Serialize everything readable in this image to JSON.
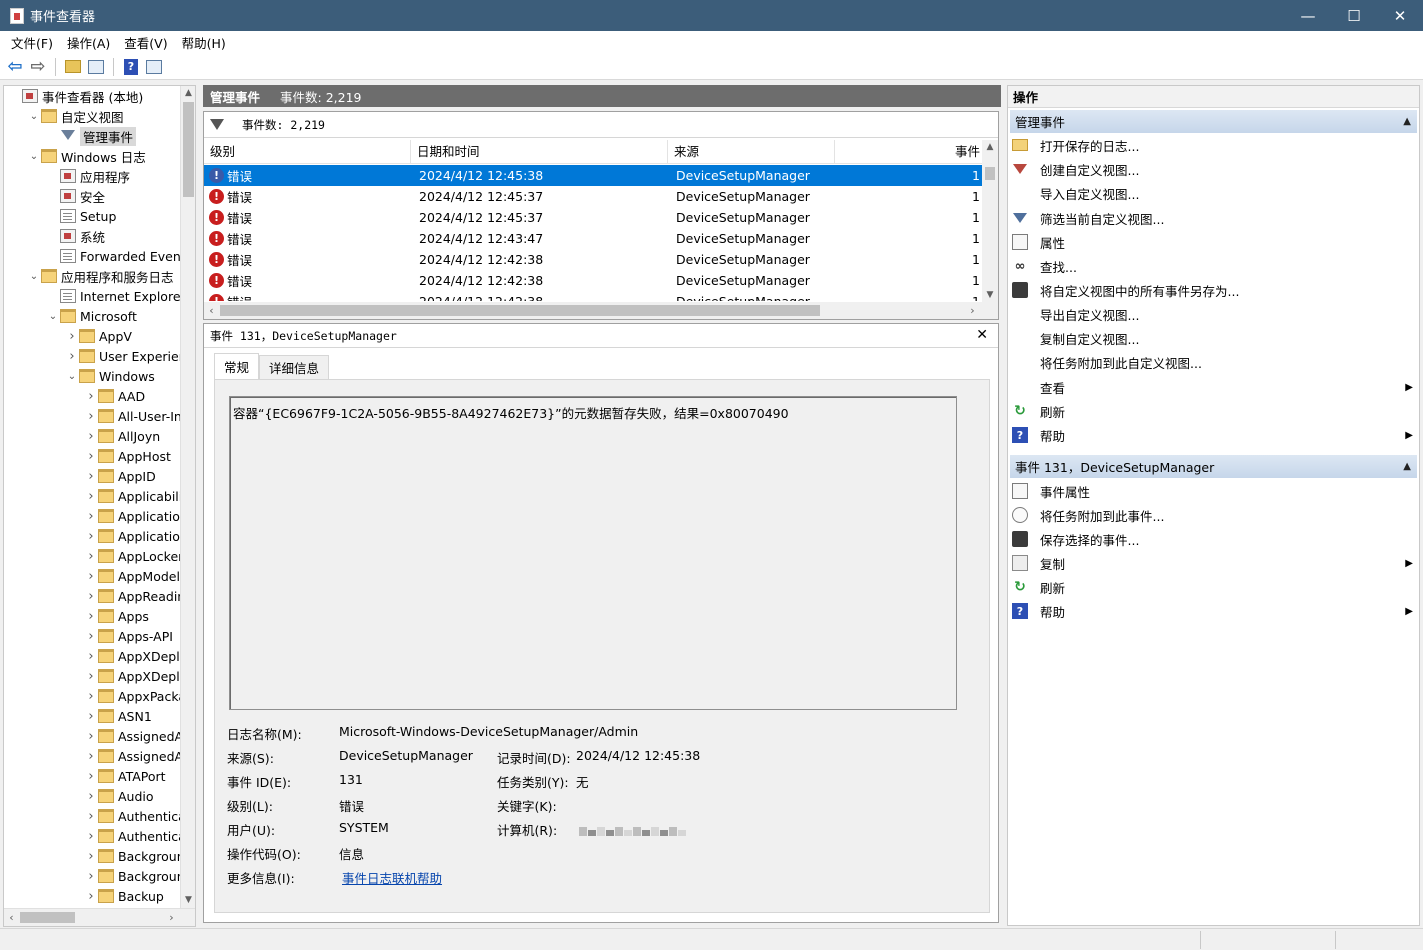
{
  "window": {
    "title": "事件查看器",
    "minimize": "—",
    "maximize": "☐",
    "close": "✕"
  },
  "menu": [
    "文件(F)",
    "操作(A)",
    "查看(V)",
    "帮助(H)"
  ],
  "tree": {
    "items": [
      {
        "label": "事件查看器 (本地)",
        "icon": "ev",
        "exp": "",
        "indent": 0
      },
      {
        "label": "自定义视图",
        "icon": "folder",
        "exp": "v",
        "indent": 1
      },
      {
        "label": "管理事件",
        "icon": "filter",
        "exp": "",
        "indent": 2,
        "selected": true
      },
      {
        "label": "Windows 日志",
        "icon": "folder",
        "exp": "v",
        "indent": 1
      },
      {
        "label": "应用程序",
        "icon": "ev",
        "exp": "",
        "indent": 2
      },
      {
        "label": "安全",
        "icon": "ev",
        "exp": "",
        "indent": 2
      },
      {
        "label": "Setup",
        "icon": "log",
        "exp": "",
        "indent": 2
      },
      {
        "label": "系统",
        "icon": "ev",
        "exp": "",
        "indent": 2
      },
      {
        "label": "Forwarded Events",
        "icon": "log",
        "exp": "",
        "indent": 2
      },
      {
        "label": "应用程序和服务日志",
        "icon": "folder",
        "exp": "v",
        "indent": 1
      },
      {
        "label": "Internet Explorer",
        "icon": "log",
        "exp": "",
        "indent": 2
      },
      {
        "label": "Microsoft",
        "icon": "folder",
        "exp": "v",
        "indent": 2
      },
      {
        "label": "AppV",
        "icon": "folder",
        "exp": ">",
        "indent": 3
      },
      {
        "label": "User Experience",
        "icon": "folder",
        "exp": ">",
        "indent": 3
      },
      {
        "label": "Windows",
        "icon": "folder",
        "exp": "v",
        "indent": 3
      },
      {
        "label": "AAD",
        "icon": "folder",
        "exp": ">",
        "indent": 4
      },
      {
        "label": "All-User-Insta",
        "icon": "folder",
        "exp": ">",
        "indent": 4
      },
      {
        "label": "AllJoyn",
        "icon": "folder",
        "exp": ">",
        "indent": 4
      },
      {
        "label": "AppHost",
        "icon": "folder",
        "exp": ">",
        "indent": 4
      },
      {
        "label": "AppID",
        "icon": "folder",
        "exp": ">",
        "indent": 4
      },
      {
        "label": "ApplicabilityE",
        "icon": "folder",
        "exp": ">",
        "indent": 4
      },
      {
        "label": "Application S",
        "icon": "folder",
        "exp": ">",
        "indent": 4
      },
      {
        "label": "Application-E",
        "icon": "folder",
        "exp": ">",
        "indent": 4
      },
      {
        "label": "AppLocker",
        "icon": "folder",
        "exp": ">",
        "indent": 4
      },
      {
        "label": "AppModel-R",
        "icon": "folder",
        "exp": ">",
        "indent": 4
      },
      {
        "label": "AppReadines",
        "icon": "folder",
        "exp": ">",
        "indent": 4
      },
      {
        "label": "Apps",
        "icon": "folder",
        "exp": ">",
        "indent": 4
      },
      {
        "label": "Apps-API",
        "icon": "folder",
        "exp": ">",
        "indent": 4
      },
      {
        "label": "AppXDeployr",
        "icon": "folder",
        "exp": ">",
        "indent": 4
      },
      {
        "label": "AppXDeployr",
        "icon": "folder",
        "exp": ">",
        "indent": 4
      },
      {
        "label": "AppxPackagi",
        "icon": "folder",
        "exp": ">",
        "indent": 4
      },
      {
        "label": "ASN1",
        "icon": "folder",
        "exp": ">",
        "indent": 4
      },
      {
        "label": "AssignedAcce",
        "icon": "folder",
        "exp": ">",
        "indent": 4
      },
      {
        "label": "AssignedAcce",
        "icon": "folder",
        "exp": ">",
        "indent": 4
      },
      {
        "label": "ATAPort",
        "icon": "folder",
        "exp": ">",
        "indent": 4
      },
      {
        "label": "Audio",
        "icon": "folder",
        "exp": ">",
        "indent": 4
      },
      {
        "label": "Authenticatio",
        "icon": "folder",
        "exp": ">",
        "indent": 4
      },
      {
        "label": "Authenticatio",
        "icon": "folder",
        "exp": ">",
        "indent": 4
      },
      {
        "label": "BackgroundT",
        "icon": "folder",
        "exp": ">",
        "indent": 4
      },
      {
        "label": "BackgroundT",
        "icon": "folder",
        "exp": ">",
        "indent": 4
      },
      {
        "label": "Backup",
        "icon": "folder",
        "exp": ">",
        "indent": 4
      }
    ]
  },
  "middle": {
    "header_title": "管理事件",
    "header_count": "事件数: 2,219",
    "filter_text": "事件数: 2,219",
    "columns": [
      "级别",
      "日期和时间",
      "来源",
      "事件"
    ],
    "rows": [
      {
        "level": "错误",
        "datetime": "2024/4/12 12:45:38",
        "source": "DeviceSetupManager",
        "event": "1",
        "selected": true
      },
      {
        "level": "错误",
        "datetime": "2024/4/12 12:45:37",
        "source": "DeviceSetupManager",
        "event": "1"
      },
      {
        "level": "错误",
        "datetime": "2024/4/12 12:45:37",
        "source": "DeviceSetupManager",
        "event": "1"
      },
      {
        "level": "错误",
        "datetime": "2024/4/12 12:43:47",
        "source": "DeviceSetupManager",
        "event": "1"
      },
      {
        "level": "错误",
        "datetime": "2024/4/12 12:42:38",
        "source": "DeviceSetupManager",
        "event": "1"
      },
      {
        "level": "错误",
        "datetime": "2024/4/12 12:42:38",
        "source": "DeviceSetupManager",
        "event": "1"
      },
      {
        "level": "错误",
        "datetime": "2024/4/12 12:42:38",
        "source": "DeviceSetupManager",
        "event": "1"
      }
    ]
  },
  "detail": {
    "title": "事件 131，DeviceSetupManager",
    "close": "✕",
    "tabs": [
      "常规",
      "详细信息"
    ],
    "message": "容器“{EC6967F9-1C2A-5056-9B55-8A4927462E73}”的元数据暂存失败，结果=0x80070490",
    "props": {
      "log_name_label": "日志名称(M):",
      "log_name": "Microsoft-Windows-DeviceSetupManager/Admin",
      "source_label": "来源(S):",
      "source": "DeviceSetupManager",
      "logged_label": "记录时间(D):",
      "logged": "2024/4/12 12:45:38",
      "event_id_label": "事件 ID(E):",
      "event_id": "131",
      "task_label": "任务类别(Y):",
      "task": "无",
      "level_label": "级别(L):",
      "level": "错误",
      "keywords_label": "关键字(K):",
      "user_label": "用户(U):",
      "user": "SYSTEM",
      "computer_label": "计算机(R):",
      "opcode_label": "操作代码(O):",
      "opcode": "信息",
      "more_label": "更多信息(I):",
      "more_link": "事件日志联机帮助"
    }
  },
  "actions": {
    "header": "操作",
    "section1": "管理事件",
    "items1": [
      {
        "label": "打开保存的日志...",
        "icon": "open"
      },
      {
        "label": "创建自定义视图...",
        "icon": "filterr"
      },
      {
        "label": "导入自定义视图...",
        "icon": ""
      },
      {
        "label": "筛选当前自定义视图...",
        "icon": "filter"
      },
      {
        "label": "属性",
        "icon": "doc"
      },
      {
        "label": "查找...",
        "icon": "find"
      },
      {
        "label": "将自定义视图中的所有事件另存为...",
        "icon": "save"
      },
      {
        "label": "导出自定义视图...",
        "icon": ""
      },
      {
        "label": "复制自定义视图...",
        "icon": ""
      },
      {
        "label": "将任务附加到此自定义视图...",
        "icon": ""
      },
      {
        "label": "查看",
        "icon": "",
        "sub": true
      },
      {
        "label": "刷新",
        "icon": "refresh"
      },
      {
        "label": "帮助",
        "icon": "help",
        "sub": true
      }
    ],
    "section2": "事件 131，DeviceSetupManager",
    "items2": [
      {
        "label": "事件属性",
        "icon": "doc"
      },
      {
        "label": "将任务附加到此事件...",
        "icon": "task"
      },
      {
        "label": "保存选择的事件...",
        "icon": "save"
      },
      {
        "label": "复制",
        "icon": "copy",
        "sub": true
      },
      {
        "label": "刷新",
        "icon": "refresh"
      },
      {
        "label": "帮助",
        "icon": "help",
        "sub": true
      }
    ]
  }
}
